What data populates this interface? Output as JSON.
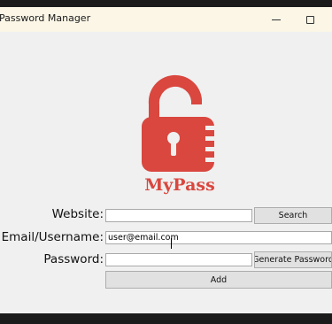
{
  "window": {
    "title": "Password Manager"
  },
  "logo": {
    "text": "MyPass",
    "color": "#d9473f"
  },
  "form": {
    "website_label": "Website:",
    "website_value": "",
    "email_label": "Email/Username:",
    "email_value": "user@email.com",
    "password_label": "Password:",
    "password_value": ""
  },
  "buttons": {
    "search": "Search",
    "generate": "Generate Password",
    "add": "Add"
  },
  "icons": {
    "minimize": "minimize-icon",
    "maximize": "maximize-icon",
    "lock": "padlock-icon"
  }
}
